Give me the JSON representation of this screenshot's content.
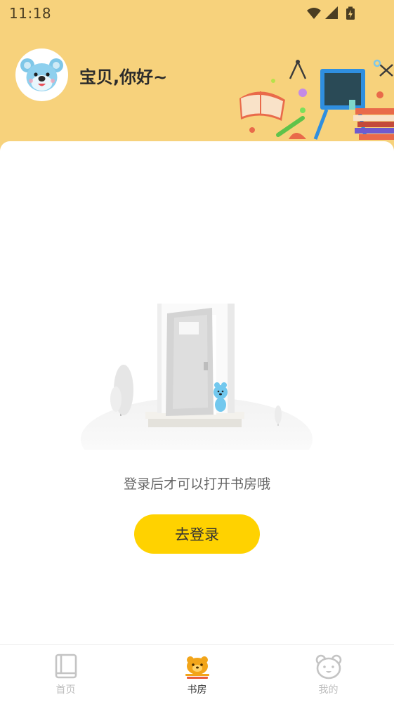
{
  "status_bar": {
    "time": "11:18",
    "icons": [
      "wifi-icon",
      "signal-icon",
      "battery-charging-icon"
    ]
  },
  "header": {
    "greeting": "宝贝,你好~",
    "avatar_icon": "koala-avatar-icon",
    "background_color": "#F7D27C"
  },
  "empty_state": {
    "message": "登录后才可以打开书房哦",
    "illustration": "door-illustration"
  },
  "login_button": {
    "label": "去登录",
    "color": "#FFD200"
  },
  "tabbar": {
    "tabs": [
      {
        "label": "首页",
        "icon": "book-icon",
        "active": false
      },
      {
        "label": "书房",
        "icon": "bear-book-icon",
        "active": true
      },
      {
        "label": "我的",
        "icon": "bear-face-icon",
        "active": false
      }
    ]
  }
}
